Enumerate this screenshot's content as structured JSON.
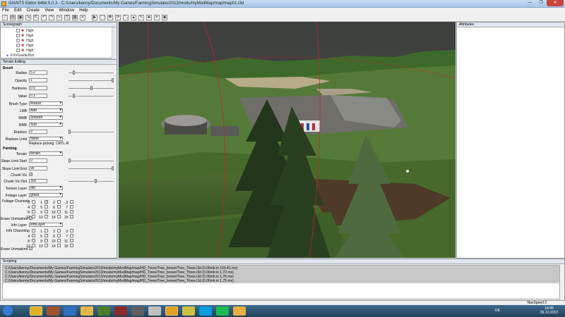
{
  "window": {
    "title": "GIANTS Editor 64bit 5.0.3 - C:/Users/kenny/Documents/My Games/FarmingSimulator2013/mods/myModMap/map/map01.i3d",
    "min_label": "—",
    "max_label": "❐",
    "close_label": "✕"
  },
  "menu": [
    "File",
    "Edit",
    "Create",
    "View",
    "Window",
    "Help"
  ],
  "toolbar_icons": [
    "new-icon",
    "open-icon",
    "save-icon",
    "import-icon",
    "export-icon",
    "undo-icon",
    "redo-icon",
    "cut-icon",
    "copy-icon",
    "paste-icon",
    "delete-icon",
    "play-icon",
    "select-tool-icon",
    "move-tool-icon",
    "rotate-tool-icon",
    "scale-tool-icon",
    "terrain-tool-icon",
    "paint-tool-icon",
    "foliage-tool-icon",
    "light-icon",
    "camera-icon"
  ],
  "scenegraph": {
    "title": "Scenegraph",
    "items": [
      "High",
      "High",
      "High",
      "High",
      "High",
      "FXVGrade20m"
    ]
  },
  "terrain": {
    "title": "Terrain Editing",
    "brush_title": "Brush",
    "radius_label": "Radius",
    "radius_value": "5.2",
    "radius_level": 0.1,
    "opacity_label": "Opacity",
    "opacity_value": "1",
    "opacity_level": 1.0,
    "hardness_label": "Hardness",
    "hardness_value": "0.5",
    "hardness_level": 0.5,
    "value_label": "Value",
    "value_value": "0.1",
    "value_level": 0.1,
    "brush_type_label": "Brush Type",
    "brush_type": "Round",
    "lmb_label": "LMB",
    "lmb": "Add",
    "mmb_label": "MMB",
    "mmb": "Smooth",
    "rmb_label": "RMB",
    "rmb": "Sub",
    "replace_label": "Replace",
    "replace_value": "0",
    "replace_level": 0.0,
    "replace_limit_label": "Replace Limit",
    "replace_limit": "None",
    "replace_picking_note": "Replace picking: CRTL-R",
    "painting_title": "Painting",
    "terrain_label": "Terrain",
    "terrain_value": "terrain",
    "slope_start_label": "Slope Limit Start",
    "slope_start_value": "0",
    "slope_start_level": 0.0,
    "slope_end_label": "Slope Limit End",
    "slope_end_value": "90",
    "slope_end_level": 1.0,
    "chunk_vis_label": "Chunk Vis",
    "chunk_vis_check": "✓",
    "chunk_vis_dist_label": "Chunk Vis Dist",
    "chunk_vis_dist_value": "300",
    "chunk_vis_dist_level": 0.6,
    "texture_layer_label": "Texture Layer",
    "texture_layer": "dirt",
    "foliage_layer_label": "Foliage Layer",
    "foliage_layer": "grass",
    "foliage_channels_label": "Foliage Channels",
    "channel_numbers": [
      "0",
      "1",
      "2",
      "3",
      "4",
      "5",
      "6",
      "7",
      "8",
      "9",
      "10",
      "11",
      "12",
      "13",
      "14",
      "15"
    ],
    "foliage_checked_mark": "✓",
    "erase_unmasked_label": "Erase Unmasked",
    "erase_unmasked_check": "✓",
    "info_layer_label": "Info Layer",
    "info_layer": "infoLayer",
    "info_channels_label": "Info Channels",
    "erase_unmasked2_label": "Erase Unmasked",
    "erase_unmasked2_check": "✓"
  },
  "attributes": {
    "title": "Attributes"
  },
  "scripting": {
    "title": "Scripting",
    "lines": [
      "C:/Users/kenny/Documents/My Games/FarmingSimulator2013/mods/myModMap/map/HD_Trees/Tree_brown/Tree_Three.i3d (0.06mb in 103.41 ms)",
      "C:/Users/kenny/Documents/My Games/FarmingSimulator2013/mods/myModMap/map/HD_Trees/Tree_brown/Tree_Three.i3d (0.06mb in 1.72 ms)",
      "C:/Users/kenny/Documents/My Games/FarmingSimulator2013/mods/myModMap/map/HD_Trees/Tree_brown/Tree_Three.i3d (0.06mb in 1.76 ms)",
      "C:/Users/kenny/Documents/My Games/FarmingSimulator2013/mods/myModMap/map/HD_Trees/Tree_brown/Tree_Three.i3d (0.06mb in 1.75 ms)"
    ]
  },
  "statusbar": {
    "speed": "NavSpeed 3"
  },
  "taskbar": {
    "apps": [
      "start-orb-icon",
      "chrome-icon",
      "game-icon",
      "league-icon",
      "explorer-icon",
      "media-icon",
      "video-icon",
      "tool-icon",
      "tool2-icon",
      "giants-editor-icon",
      "note-icon",
      "skype-icon",
      "spotify-icon",
      "folder-icon"
    ],
    "lang": "DE",
    "time": "14:45",
    "date": "06.10.2013"
  }
}
